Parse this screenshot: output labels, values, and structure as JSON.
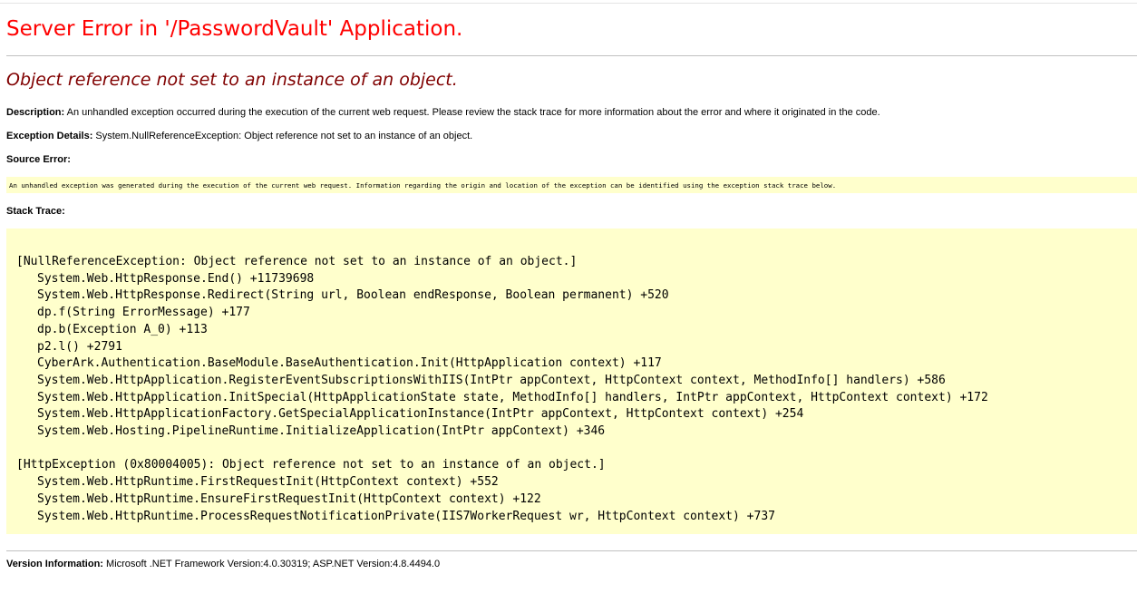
{
  "page": {
    "title": "Server Error in '/PasswordVault' Application.",
    "message": "Object reference not set to an instance of an object."
  },
  "description": {
    "label": "Description:",
    "text": " An unhandled exception occurred during the execution of the current web request. Please review the stack trace for more information about the error and where it originated in the code."
  },
  "exception_details": {
    "label": "Exception Details:",
    "text": " System.NullReferenceException: Object reference not set to an instance of an object."
  },
  "source_error": {
    "label": "Source Error:",
    "text": "An unhandled exception was generated during the execution of the current web request. Information regarding the origin and location of the exception can be identified using the exception stack trace below."
  },
  "stack_trace": {
    "label": "Stack Trace:",
    "exception1": {
      "header": "[NullReferenceException: Object reference not set to an instance of an object.]",
      "frames": [
        "System.Web.HttpResponse.End() +11739698",
        "System.Web.HttpResponse.Redirect(String url, Boolean endResponse, Boolean permanent) +520",
        "dp.f(String ErrorMessage) +177",
        "dp.b(Exception A_0) +113",
        "p2.l() +2791",
        "CyberArk.Authentication.BaseModule.BaseAuthentication.Init(HttpApplication context) +117",
        "System.Web.HttpApplication.RegisterEventSubscriptionsWithIIS(IntPtr appContext, HttpContext context, MethodInfo[] handlers) +586",
        "System.Web.HttpApplication.InitSpecial(HttpApplicationState state, MethodInfo[] handlers, IntPtr appContext, HttpContext context) +172",
        "System.Web.HttpApplicationFactory.GetSpecialApplicationInstance(IntPtr appContext, HttpContext context) +254",
        "System.Web.Hosting.PipelineRuntime.InitializeApplication(IntPtr appContext) +346"
      ]
    },
    "exception2": {
      "header": "[HttpException (0x80004005): Object reference not set to an instance of an object.]",
      "frames": [
        "System.Web.HttpRuntime.FirstRequestInit(HttpContext context) +552",
        "System.Web.HttpRuntime.EnsureFirstRequestInit(HttpContext context) +122",
        "System.Web.HttpRuntime.ProcessRequestNotificationPrivate(IIS7WorkerRequest wr, HttpContext context) +737"
      ]
    }
  },
  "version_information": {
    "label": "Version Information:",
    "text": " Microsoft .NET Framework Version:4.0.30319; ASP.NET Version:4.8.4494.0"
  }
}
